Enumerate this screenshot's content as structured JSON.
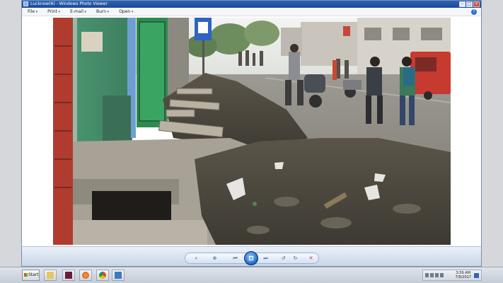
{
  "window": {
    "title": "Lucknow(6) - Windows Photo Viewer"
  },
  "menu": {
    "items": [
      "File",
      "Print",
      "E-mail",
      "Burn",
      "Open"
    ]
  },
  "icons": {
    "app": "photo-viewer-icon",
    "help": "help-icon",
    "minimize": "minimize-icon",
    "maximize": "maximize-icon",
    "close": "close-icon"
  },
  "controls": {
    "zoom": "zoom-icon",
    "fit": "actual-size-icon",
    "previous": "previous-icon",
    "slideshow": "slideshow-icon",
    "next": "next-icon",
    "rotate_left": "rotate-left-icon",
    "rotate_right": "rotate-right-icon",
    "delete": "delete-icon"
  },
  "taskbar": {
    "start_label": "Start",
    "pinned": [
      "explorer-icon",
      "indesign-icon",
      "firefox-icon",
      "chrome-icon",
      "photo-viewer-icon"
    ],
    "clock_time": "3:59 AM",
    "clock_date": "7/9/2017"
  },
  "colors": {
    "titlebar": "#1b4a96",
    "close_button": "#c94a3b",
    "slideshow_button": "#1e63c3"
  }
}
